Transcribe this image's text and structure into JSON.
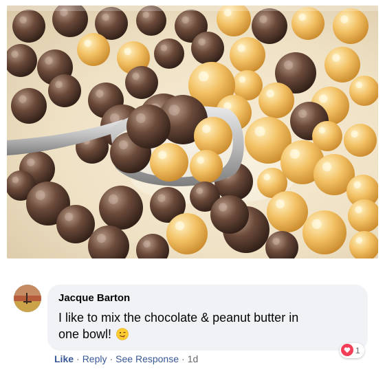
{
  "post": {
    "photo_alt": "",
    "photo_icon": "cereal-photo"
  },
  "comment": {
    "author": "Jacque Barton",
    "text": "I like to mix the chocolate & peanut butter in one bowl!",
    "emoji": "winking-tongue-emoji",
    "reaction_icon": "heart-reaction-icon",
    "reaction_color": "#f33e58",
    "reaction_count": "1",
    "actions": {
      "like": "Like",
      "reply": "Reply",
      "see_response": "See Response",
      "separator": "·",
      "time": "1d"
    }
  },
  "colors": {
    "bubble_bg": "#f0f2f5",
    "link": "#385898",
    "meta": "#65676b"
  }
}
